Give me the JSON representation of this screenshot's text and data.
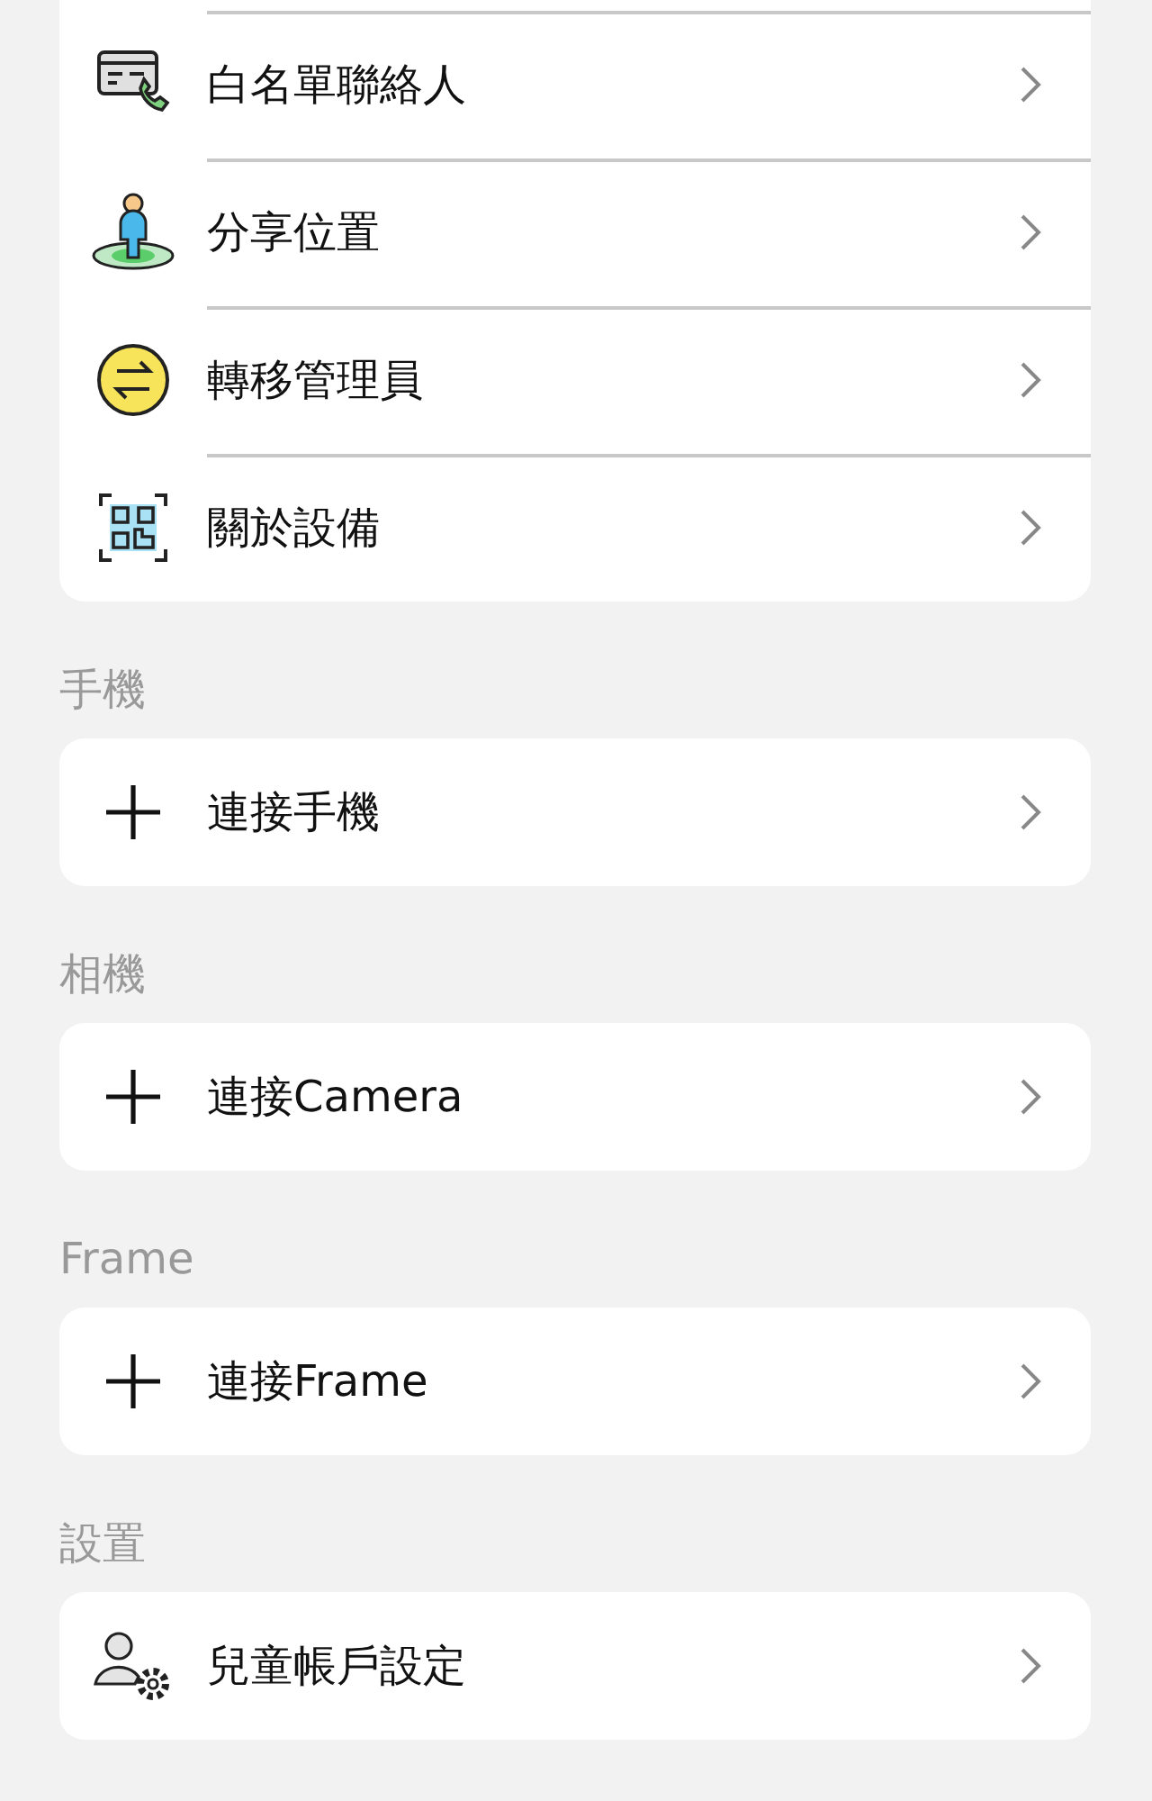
{
  "sections": [
    {
      "items": [
        {
          "label": "白名單聯絡人"
        },
        {
          "label": "分享位置"
        },
        {
          "label": "轉移管理員"
        },
        {
          "label": "關於設備"
        }
      ]
    },
    {
      "header": "手機",
      "items": [
        {
          "label": "連接手機"
        }
      ]
    },
    {
      "header": "相機",
      "items": [
        {
          "label": "連接Camera"
        }
      ]
    },
    {
      "header": "Frame",
      "items": [
        {
          "label": "連接Frame"
        }
      ]
    },
    {
      "header": "設置",
      "items": [
        {
          "label": "兒童帳戶設定"
        }
      ]
    }
  ]
}
